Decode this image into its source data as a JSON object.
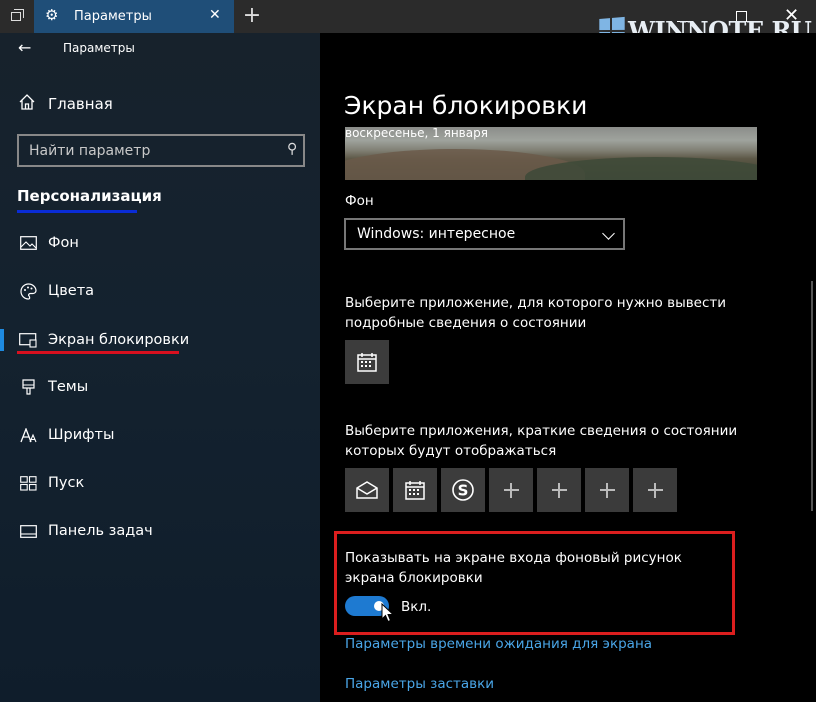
{
  "window": {
    "tab_title": "Параметры",
    "close_glyph": "✕",
    "new_tab_glyph": "+",
    "watermark": "WINNOTE.RU"
  },
  "sidebar": {
    "back_glyph": "←",
    "app_title": "Параметры",
    "home_label": "Главная",
    "search_placeholder": "Найти параметр",
    "section": "Персонализация",
    "items": [
      {
        "label": "Фон",
        "icon": "picture-icon"
      },
      {
        "label": "Цвета",
        "icon": "palette-icon"
      },
      {
        "label": "Экран блокировки",
        "icon": "lock-screen-icon",
        "selected": true
      },
      {
        "label": "Темы",
        "icon": "brush-icon"
      },
      {
        "label": "Шрифты",
        "icon": "font-icon"
      },
      {
        "label": "Пуск",
        "icon": "start-icon"
      },
      {
        "label": "Панель задач",
        "icon": "taskbar-icon"
      }
    ]
  },
  "main": {
    "title": "Экран блокировки",
    "preview_date": "воскресенье, 1 января",
    "background_label": "Фон",
    "background_value": "Windows: интересное",
    "detailed_status_text": "Выберите приложение, для которого нужно вывести подробные сведения о состоянии",
    "quick_status_text": "Выберите приложения, краткие сведения о состоянии которых будут отображаться",
    "quick_tiles": [
      "mail-icon",
      "calendar-icon",
      "skype-icon",
      "plus",
      "plus",
      "plus",
      "plus"
    ],
    "signin_bg_text": "Показывать на экране входа фоновый рисунок экрана блокировки",
    "toggle_state": "Вкл.",
    "toggle_on": true,
    "link_timeout": "Параметры времени ожидания для экрана",
    "link_screensaver": "Параметры заставки"
  },
  "colors": {
    "accent": "#1e7ad1",
    "link": "#4aa6e8",
    "highlight_red": "#dc1e1e",
    "highlight_blue": "#0a2cd6"
  }
}
